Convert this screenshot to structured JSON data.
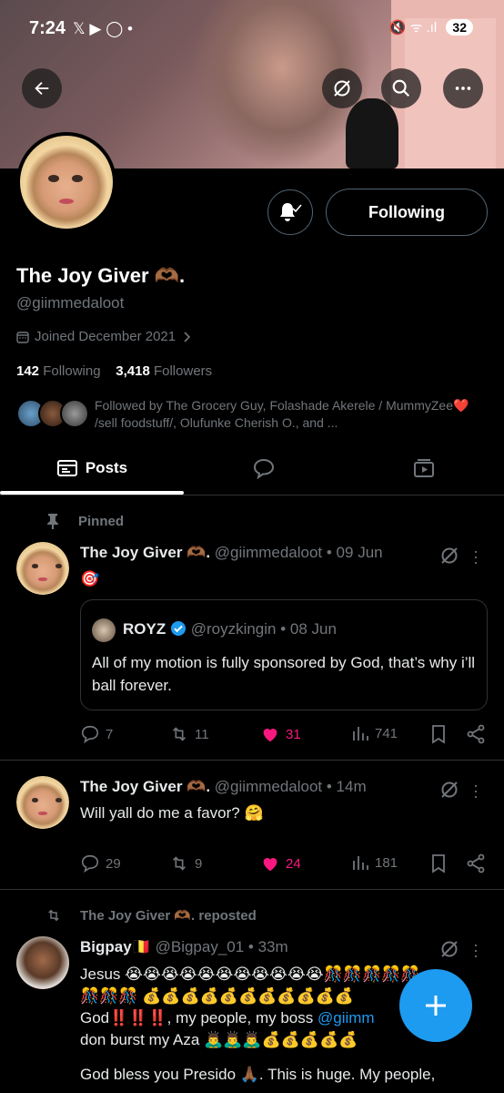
{
  "status_bar": {
    "time": "7:24",
    "apps": "𝕏 ▶ ◯ •",
    "signal": "🔇 ᯤ .ıl",
    "battery": "32"
  },
  "profile": {
    "name": "The Joy Giver 🫶🏾.",
    "handle": "@giimmedaloot",
    "joined": "Joined December 2021",
    "following_count": "142",
    "following_label": "Following",
    "followers_count": "3,418",
    "followers_label": "Followers",
    "followed_by": "Followed by The Grocery Guy, Folashade Akerele / MummyZee❤️ /sell foodstuff/, Olufunke Cherish O., and ...",
    "follow_button": "Following"
  },
  "tabs": [
    {
      "label": "Posts"
    }
  ],
  "pinned_label": "Pinned",
  "posts": [
    {
      "name": "The Joy Giver 🫶🏾.",
      "meta": "@giimmedaloot • 09 Jun",
      "text": "🎯",
      "quote": {
        "name": "ROYZ",
        "meta": "@royzkingin • 08 Jun",
        "text": "All of my motion is fully sponsored by God, that’s why i’ll ball forever."
      },
      "replies": "7",
      "reposts": "11",
      "likes": "31",
      "views": "741"
    },
    {
      "name": "The Joy Giver 🫶🏾.",
      "meta": "@giimmedaloot • 14m",
      "text": "Will yall do me a favor? 🤗",
      "replies": "29",
      "reposts": "9",
      "likes": "24",
      "views": "181"
    },
    {
      "repost_label": "The Joy Giver 🫶🏾. reposted",
      "name": "Bigpay🇧🇪",
      "meta": "@Bigpay_01 • 33m",
      "line1": "Jesus 😭😭😭😭😭😭😭😭😭😭😭🎊🎊🎊🎊🎊",
      "line2": "🎊🎊🎊 💰💰💰💰💰💰💰💰💰💰💰",
      "line3_a": "God‼️‼️‼️, my people,  my boss ",
      "line3_mention": "@giimm",
      "line4": "don burst my Aza 🙇‍♂️🙇‍♂️🙇‍♂️💰💰💰💰💰",
      "line5": "God bless you Presido 🙏🏾. This is huge. My people,"
    }
  ],
  "colors": {
    "accent": "#1d9bf0",
    "like": "#f91880",
    "muted": "#71767b"
  }
}
